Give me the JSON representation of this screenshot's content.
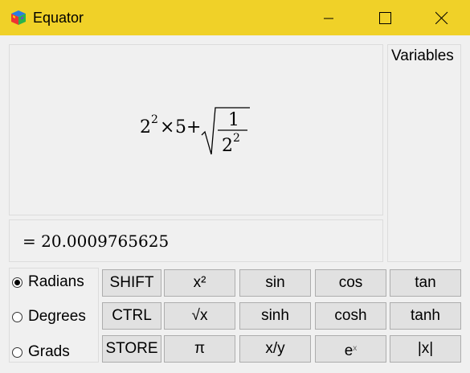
{
  "window": {
    "title": "Equator"
  },
  "expression": {
    "base1": "2",
    "exp1": "2",
    "times": "×",
    "five": "5",
    "plus": "+",
    "numerator": "1",
    "den_base": "2",
    "den_exp": "2"
  },
  "result": {
    "text": "= 20.0009765625"
  },
  "variables": {
    "label": "Variables"
  },
  "units": {
    "options": [
      "Radians",
      "Degrees",
      "Grads"
    ],
    "selected": "Radians"
  },
  "keypad": {
    "rows": [
      [
        "SHIFT",
        "x²",
        "sin",
        "cos",
        "tan"
      ],
      [
        "CTRL",
        "√x",
        "sinh",
        "cosh",
        "tanh"
      ],
      [
        "STORE",
        "π",
        "x/y",
        "e",
        "|x|"
      ]
    ],
    "exp_superscript": "x"
  },
  "colors": {
    "titlebar": "#f0d128",
    "background": "#f0f0f0",
    "button": "#e1e1e1"
  }
}
